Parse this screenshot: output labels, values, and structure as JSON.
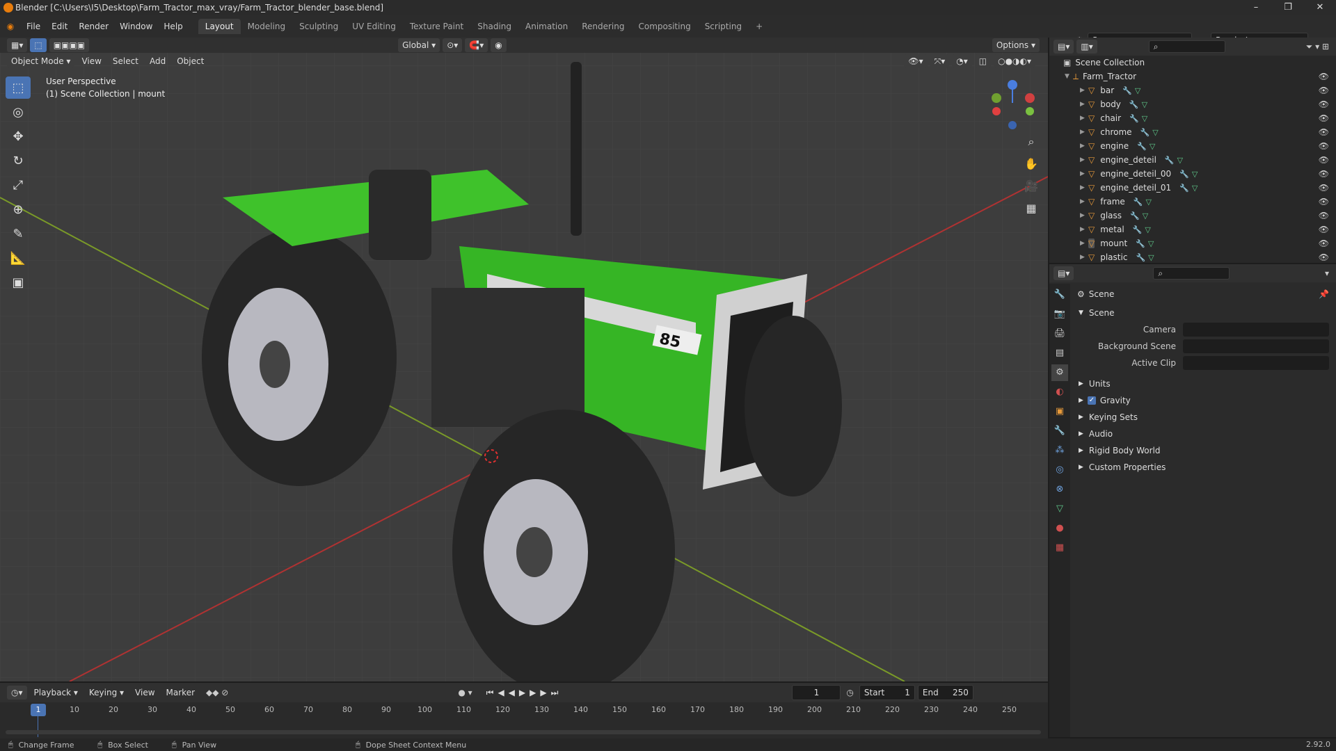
{
  "window": {
    "title": "Blender [C:\\Users\\I5\\Desktop\\Farm_Tractor_max_vray/Farm_Tractor_blender_base.blend]",
    "controls": [
      "–",
      "❐",
      "✕"
    ]
  },
  "menu": [
    "File",
    "Edit",
    "Render",
    "Window",
    "Help"
  ],
  "workspaces": [
    "Layout",
    "Modeling",
    "Sculpting",
    "UV Editing",
    "Texture Paint",
    "Shading",
    "Animation",
    "Rendering",
    "Compositing",
    "Scripting",
    "+"
  ],
  "active_workspace": "Layout",
  "scene_field": "Scene",
  "renderlayer_field": "RenderLayer",
  "viewport": {
    "mode": "Object Mode",
    "menus": [
      "View",
      "Select",
      "Add",
      "Object"
    ],
    "orientation": "Global",
    "options": "Options",
    "perspective_label": "User Perspective",
    "collection_label": "(1) Scene Collection | mount",
    "tractor_number": "85"
  },
  "outliner": {
    "root": "Scene Collection",
    "collection": "Farm_Tractor",
    "items": [
      "bar",
      "body",
      "chair",
      "chrome",
      "engine",
      "engine_deteil",
      "engine_deteil_00",
      "engine_deteil_01",
      "frame",
      "glass",
      "metal",
      "mount",
      "plastic"
    ]
  },
  "properties": {
    "header": "Scene",
    "panel": "Scene",
    "fields": [
      {
        "label": "Camera"
      },
      {
        "label": "Background Scene"
      },
      {
        "label": "Active Clip"
      }
    ],
    "sections": [
      "Units",
      "Gravity",
      "Keying Sets",
      "Audio",
      "Rigid Body World",
      "Custom Properties"
    ],
    "gravity_checked": true
  },
  "timeline": {
    "menus": [
      "Playback",
      "Keying",
      "View",
      "Marker"
    ],
    "current_frame": "1",
    "start_label": "Start",
    "start": "1",
    "end_label": "End",
    "end": "250",
    "ticks": [
      "10",
      "20",
      "30",
      "40",
      "50",
      "60",
      "70",
      "80",
      "90",
      "100",
      "110",
      "120",
      "130",
      "140",
      "150",
      "160",
      "170",
      "180",
      "190",
      "200",
      "210",
      "220",
      "230",
      "240",
      "250"
    ],
    "playhead": "1"
  },
  "status": {
    "items": [
      "Change Frame",
      "Box Select",
      "Pan View",
      "Dope Sheet Context Menu"
    ],
    "version": "2.92.0"
  },
  "colors": {
    "accent": "#4a74b4",
    "tractor_green": "#3fc22b",
    "grid_red": "#b03232",
    "grid_green": "#7a9a28"
  }
}
